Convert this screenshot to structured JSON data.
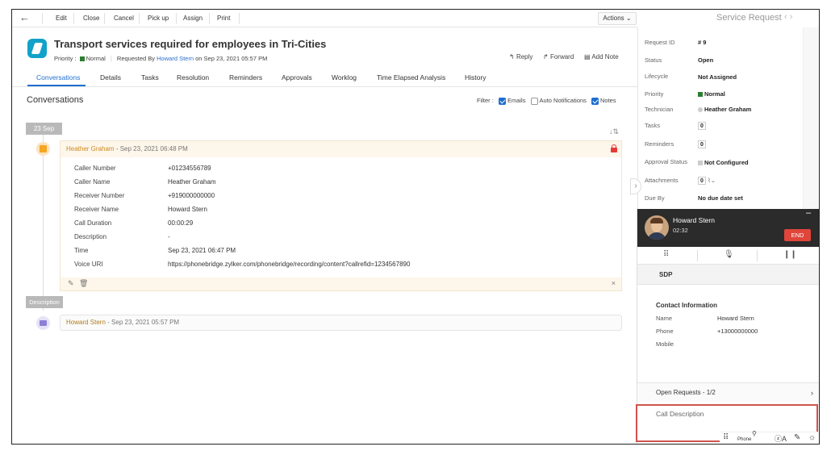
{
  "toolbar": {
    "edit": "Edit",
    "close": "Close",
    "cancel": "Cancel",
    "pickup": "Pick up",
    "assign": "Assign",
    "print": "Print",
    "actions": "Actions ⌄",
    "service_request": "Service Request"
  },
  "request": {
    "title": "Transport services required for employees in Tri-Cities",
    "priority_label": "Priority :",
    "priority": "Normal",
    "requested_by_label": "Requested By",
    "requester": "Howard Stern",
    "requested_on": "on Sep 23, 2021 05:57 PM",
    "reply": "Reply",
    "forward": "Forward",
    "add_note": "Add Note"
  },
  "tabs": [
    "Conversations",
    "Details",
    "Tasks",
    "Resolution",
    "Reminders",
    "Approvals",
    "Worklog",
    "Time Elapsed Analysis",
    "History"
  ],
  "conversations": {
    "heading": "Conversations",
    "filter_label": "Filter :",
    "filter_emails": "Emails",
    "filter_auto": "Auto Notifications",
    "filter_notes": "Notes",
    "date_pill": "23 Sep",
    "note": {
      "author": "Heather Graham",
      "time": " - Sep 23, 2021 06:48 PM",
      "rows": [
        {
          "label": "Caller Number",
          "value": "+01234556789"
        },
        {
          "label": "Caller Name",
          "value": "Heather Graham"
        },
        {
          "label": "Receiver Number",
          "value": "+919000000000"
        },
        {
          "label": "Receiver Name",
          "value": "Howard Stern"
        },
        {
          "label": "Call Duration",
          "value": "00:00:29"
        },
        {
          "label": "Description",
          "value": "-"
        },
        {
          "label": "Time",
          "value": "Sep 23, 2021 06:47 PM"
        },
        {
          "label": "Voice URI",
          "value": "https://phonebridge.zylker.com/phonebridge/recording/content?callrefid=1234567890"
        }
      ]
    },
    "desc_pill": "Description",
    "desc_author": "Howard Stern",
    "desc_time": " - Sep 23, 2021 05:57 PM"
  },
  "side": {
    "fields": [
      {
        "label": "Request ID",
        "value": "# 9"
      },
      {
        "label": "Status",
        "value": "Open"
      },
      {
        "label": "Lifecycle",
        "value": "Not Assigned"
      },
      {
        "label": "Priority",
        "value": "Normal"
      },
      {
        "label": "Technician",
        "value": "Heather Graham"
      },
      {
        "label": "Tasks",
        "value": "0"
      },
      {
        "label": "Reminders",
        "value": "0"
      },
      {
        "label": "Approval Status",
        "value": "Not Configured"
      },
      {
        "label": "Attachments",
        "value": "0"
      },
      {
        "label": "Due By",
        "value": "No due date set"
      }
    ],
    "priority_color": "#2e7d32"
  },
  "phone": {
    "caller": "Howard Stern",
    "timer": "02:32",
    "end": "END",
    "sdp": "SDP",
    "contact_heading": "Contact Information",
    "name_label": "Name",
    "name_value": "Howard Stern",
    "phone_label": "Phone",
    "phone_value": "+13000000000",
    "mobile_label": "Mobile",
    "open_requests": "Open Requests - 1/2",
    "call_description": "Call Description",
    "end_color": "#e0453a"
  },
  "bottombar": {
    "phone_label": "Phone"
  }
}
